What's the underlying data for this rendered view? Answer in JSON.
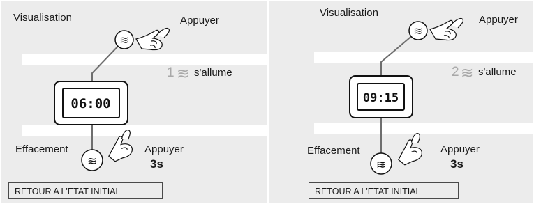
{
  "panels": [
    {
      "top_label": "Visualisation",
      "top_action": "Appuyer",
      "step_number": "1",
      "step_symbol": "≋",
      "step_text": "s'allume",
      "display_time": "06:00",
      "bottom_label": "Effacement",
      "bottom_action": "Appuyer",
      "bottom_duration": "3s",
      "reset_label": "RETOUR A L'ETAT INITIAL"
    },
    {
      "top_label": "Visualisation",
      "top_action": "Appuyer",
      "step_number": "2",
      "step_symbol": "≋",
      "step_text": "s'allume",
      "display_time": "09:15",
      "bottom_label": "Effacement",
      "bottom_action": "Appuyer",
      "bottom_duration": "3s",
      "reset_label": "RETOUR A L'ETAT INITIAL"
    }
  ],
  "button_symbol": "≋",
  "colors": {
    "panel_bg": "#ececec",
    "band": "#ffffff",
    "line": "#6e6e6e",
    "step_number": "#a8a8a8",
    "text": "#1a1a1a"
  }
}
